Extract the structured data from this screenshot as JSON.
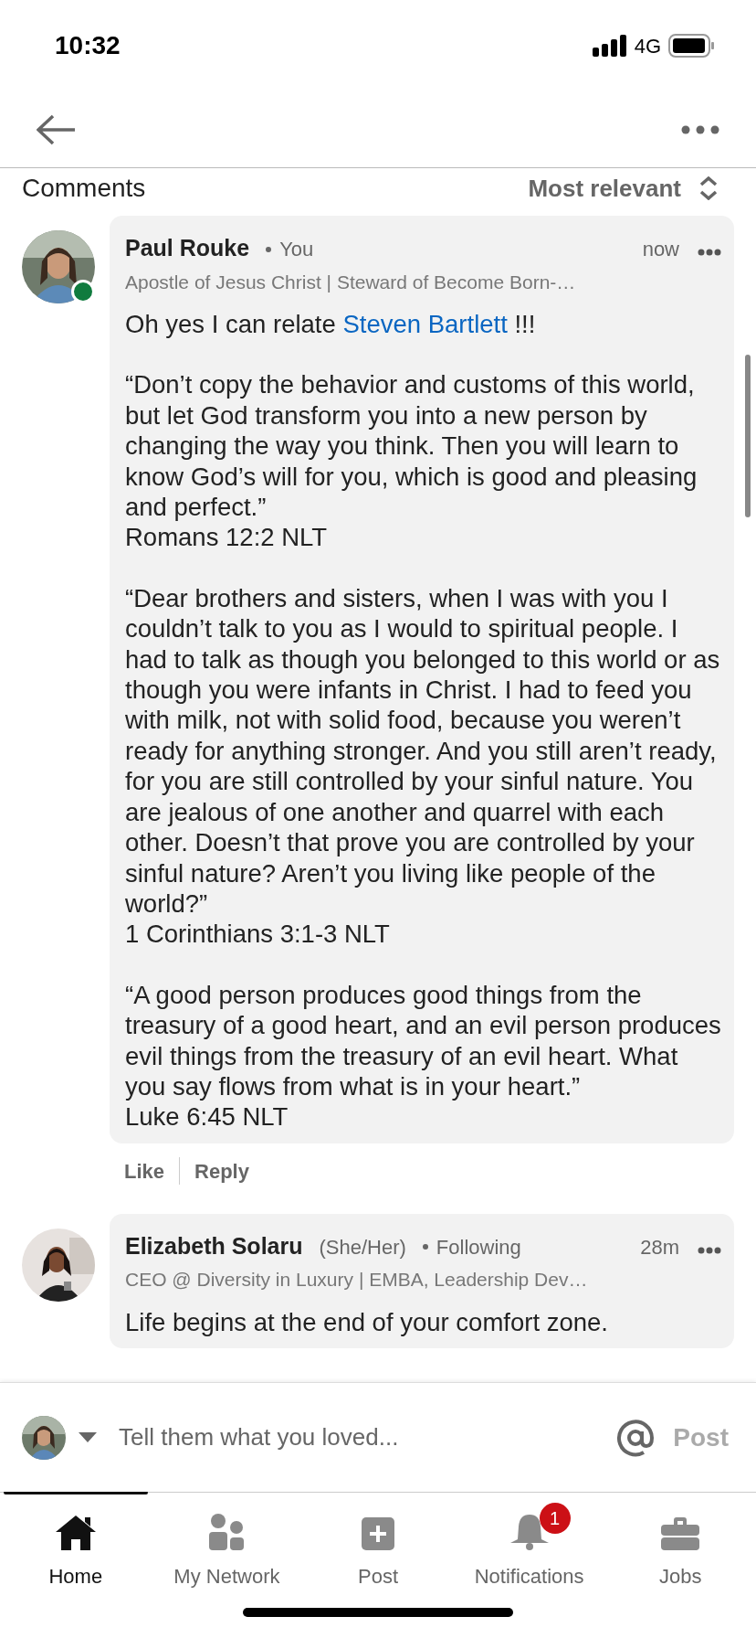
{
  "status_bar": {
    "time": "10:32",
    "network": "4G"
  },
  "header": {
    "title": "Comments",
    "sort": "Most relevant"
  },
  "comments": [
    {
      "author": "Paul Rouke",
      "relation": "You",
      "online": true,
      "time": "now",
      "headline": "Apostle of Jesus Christ | Steward of Become Born-…",
      "paragraphs": [
        [
          {
            "kind": "text",
            "text": "Oh yes I can relate "
          },
          {
            "kind": "mention",
            "text": "Steven Bartlett"
          },
          {
            "kind": "text",
            "text": " !!!"
          }
        ],
        [
          {
            "kind": "text",
            "text": "“Don’t copy the behavior and customs of this world, but let God transform you into a new person by changing the way you think. Then you will learn to know God’s will for you, which is good and pleasing and perfect.”\nRomans 12:2 NLT"
          }
        ],
        [
          {
            "kind": "text",
            "text": "“Dear brothers and sisters, when I was with you I couldn’t talk to you as I would to spiritual people. I had to talk as though you belonged to this world or as though you were infants in Christ. I had to feed you with milk, not with solid food, because you weren’t ready for anything stronger. And you still aren’t ready, for you are still controlled by your sinful nature. You are jealous of one another and quarrel with each other. Doesn’t that prove you are controlled by your sinful nature? Aren’t you living like people of the world?”\n1 Corinthians 3:1-3 NLT"
          }
        ],
        [
          {
            "kind": "text",
            "text": "“A good person produces good things from the treasury of a good heart, and an evil person produces evil things from the treasury of an evil heart. What you say flows from what is in your heart.”\nLuke 6:45 NLT"
          }
        ]
      ],
      "actions": [
        "Like",
        "Reply"
      ]
    },
    {
      "author": "Elizabeth Solaru",
      "pronouns": "(She/Her)",
      "relation": "Following",
      "online": false,
      "time": "28m",
      "headline": "CEO @ Diversity in Luxury | EMBA, Leadership Dev…",
      "paragraphs": [
        [
          {
            "kind": "text",
            "text": "Life begins at the end of your comfort zone."
          }
        ]
      ]
    }
  ],
  "composer": {
    "placeholder": "Tell them what you loved...",
    "post": "Post"
  },
  "tabs": [
    {
      "label": "Home",
      "kind": "home",
      "selected": true
    },
    {
      "label": "My Network",
      "kind": "network",
      "selected": false
    },
    {
      "label": "Post",
      "kind": "post",
      "selected": false
    },
    {
      "label": "Notifications",
      "kind": "bell",
      "selected": false,
      "badge": "1"
    },
    {
      "label": "Jobs",
      "kind": "jobs",
      "selected": false
    }
  ]
}
